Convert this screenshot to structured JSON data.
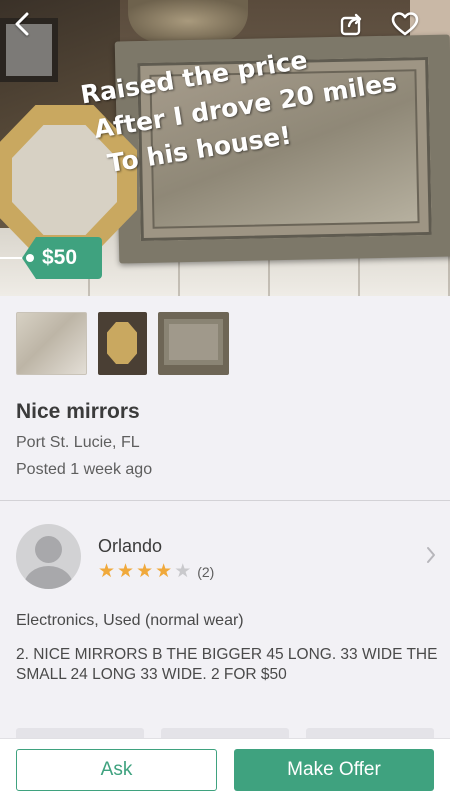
{
  "listing": {
    "overlay_lines": [
      "Raised the price",
      "After I drove 20 miles",
      "To his house!"
    ],
    "price": "$50",
    "title": "Nice mirrors",
    "location": "Port St. Lucie, FL",
    "posted": "Posted 1 week ago",
    "category": "Electronics, Used (normal wear)",
    "description": "2. NICE MIRRORS B THE BIGGER 45 LONG. 33 WIDE THE SMALL 24 LONG 33 WIDE. 2 FOR $50"
  },
  "header": {
    "icons": [
      "back-arrow-icon",
      "share-icon",
      "heart-icon"
    ]
  },
  "thumbnails": [
    "thumbnail-1",
    "thumbnail-2",
    "thumbnail-3"
  ],
  "seller": {
    "name": "Orlando",
    "rating": 4,
    "rating_max": 5,
    "review_count": "(2)"
  },
  "actions": {
    "ask_label": "Ask",
    "offer_label": "Make Offer"
  },
  "colors": {
    "accent": "#3fa27f",
    "star": "#f0a93b"
  }
}
